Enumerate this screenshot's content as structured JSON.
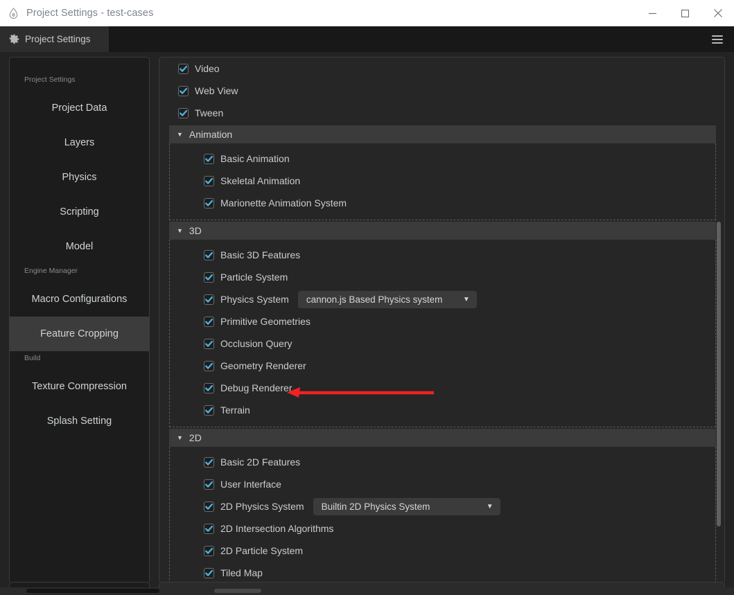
{
  "window": {
    "title": "Project Settings - test-cases",
    "app_icon": "droplet-icon",
    "controls": {
      "minimize": "minimize-icon",
      "maximize": "maximize-icon",
      "close": "close-icon"
    }
  },
  "tabbar": {
    "active_tab": "Project Settings",
    "tab_icon": "gear-icon",
    "menu_icon": "hamburger-menu-icon"
  },
  "sidebar": {
    "groups": [
      {
        "title": "Project Settings",
        "items": [
          {
            "label": "Project Data",
            "selected": false
          },
          {
            "label": "Layers",
            "selected": false
          },
          {
            "label": "Physics",
            "selected": false
          },
          {
            "label": "Scripting",
            "selected": false
          },
          {
            "label": "Model",
            "selected": false
          }
        ]
      },
      {
        "title": "Engine Manager",
        "items": [
          {
            "label": "Macro Configurations",
            "selected": false
          },
          {
            "label": "Feature Cropping",
            "selected": true
          }
        ]
      },
      {
        "title": "Build",
        "items": [
          {
            "label": "Texture Compression",
            "selected": false
          },
          {
            "label": "Splash Setting",
            "selected": false
          }
        ]
      }
    ]
  },
  "content": {
    "top_items": [
      {
        "label": "Video",
        "checked": true
      },
      {
        "label": "Web View",
        "checked": true
      },
      {
        "label": "Tween",
        "checked": true
      }
    ],
    "sections": [
      {
        "title": "Animation",
        "expanded": true,
        "caret": "▼",
        "items": [
          {
            "label": "Basic Animation",
            "checked": true
          },
          {
            "label": "Skeletal Animation",
            "checked": true
          },
          {
            "label": "Marionette Animation System",
            "checked": true
          }
        ]
      },
      {
        "title": "3D",
        "expanded": true,
        "caret": "▼",
        "items": [
          {
            "label": "Basic 3D Features",
            "checked": true
          },
          {
            "label": "Particle System",
            "checked": true
          },
          {
            "label": "Physics System",
            "checked": true,
            "dropdown": {
              "value": "cannon.js Based Physics system",
              "caret": "▼",
              "width_class": "w-cannon"
            }
          },
          {
            "label": "Primitive Geometries",
            "checked": true
          },
          {
            "label": "Occlusion Query",
            "checked": true
          },
          {
            "label": "Geometry Renderer",
            "checked": true
          },
          {
            "label": "Debug Renderer",
            "checked": true,
            "annotated": true
          },
          {
            "label": "Terrain",
            "checked": true
          }
        ]
      },
      {
        "title": "2D",
        "expanded": true,
        "caret": "▼",
        "items": [
          {
            "label": "Basic 2D Features",
            "checked": true
          },
          {
            "label": "User Interface",
            "checked": true
          },
          {
            "label": "2D Physics System",
            "checked": true,
            "dropdown": {
              "value": "Builtin 2D Physics System",
              "caret": "▼",
              "width_class": "w-builtin"
            }
          },
          {
            "label": "2D Intersection Algorithms",
            "checked": true
          },
          {
            "label": "2D Particle System",
            "checked": true
          },
          {
            "label": "Tiled Map",
            "checked": true
          }
        ]
      }
    ]
  },
  "annotation": {
    "color": "#f32121",
    "target": "Debug Renderer",
    "shape": "left-pointing-arrow"
  },
  "colors": {
    "accent_check": "#4db3e0",
    "panel_bg": "#262626",
    "sidebar_bg": "#1c1c1c",
    "selected_bg": "#3c3c3c",
    "section_header_bg": "#3b3b3b",
    "titlebar_bg": "#ffffff"
  }
}
